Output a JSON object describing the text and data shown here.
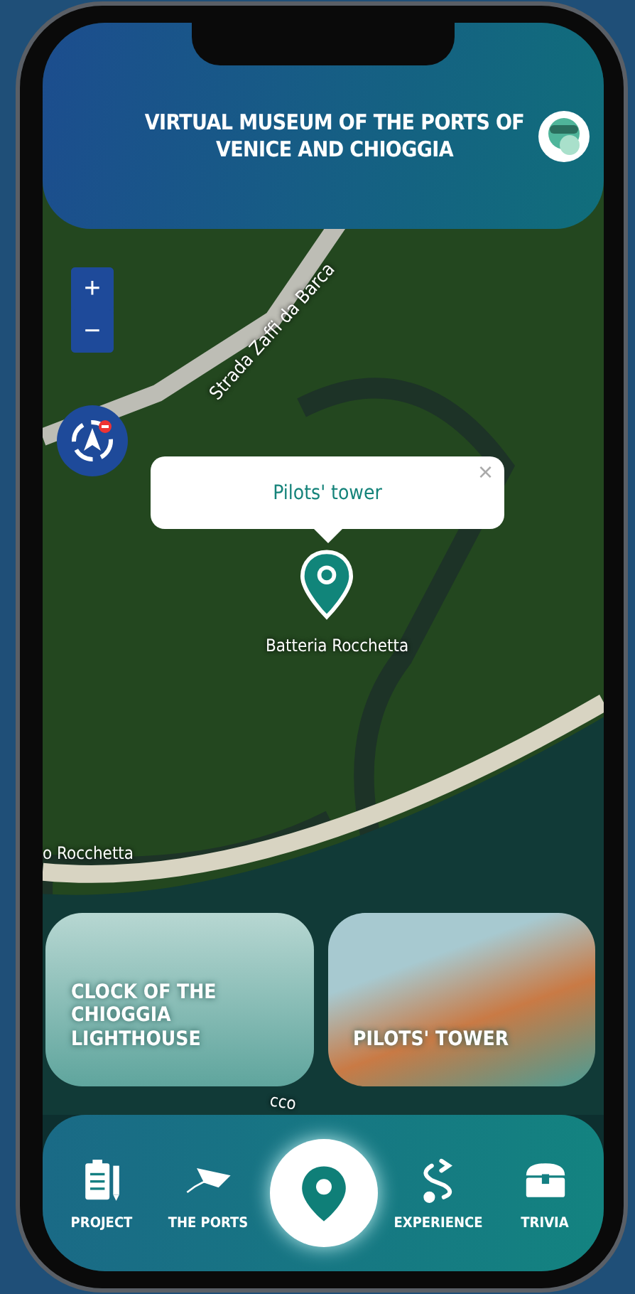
{
  "header": {
    "title": "VIRTUAL MUSEUM OF THE PORTS OF VENICE AND CHIOGGIA"
  },
  "map": {
    "labels": [
      {
        "kind": "road",
        "text": "Strada Zaffi da Barca"
      },
      {
        "kind": "place",
        "text": "o Rocchetta"
      },
      {
        "kind": "water",
        "text": "cco"
      }
    ],
    "zoom_controls": [
      "+",
      "−"
    ],
    "popup": {
      "title": "Pilots' tower",
      "close": "×"
    },
    "marker": {
      "label": "Batteria Rocchetta"
    }
  },
  "cards": [
    {
      "title": "CLOCK OF THE CHIOGGIA LIGHTHOUSE",
      "kind": "engraving"
    },
    {
      "title": "PILOTS' TOWER",
      "kind": "photo"
    }
  ],
  "nav": [
    {
      "label": "PROJECT",
      "kind": "clipboard",
      "selected": false
    },
    {
      "label": "THE PORTS",
      "kind": "plane",
      "selected": false
    },
    {
      "kind": "pin",
      "selected": true
    },
    {
      "label": "EXPERIENCE",
      "kind": "route",
      "selected": false
    },
    {
      "label": "TRIVIA",
      "kind": "chest",
      "selected": false
    }
  ]
}
